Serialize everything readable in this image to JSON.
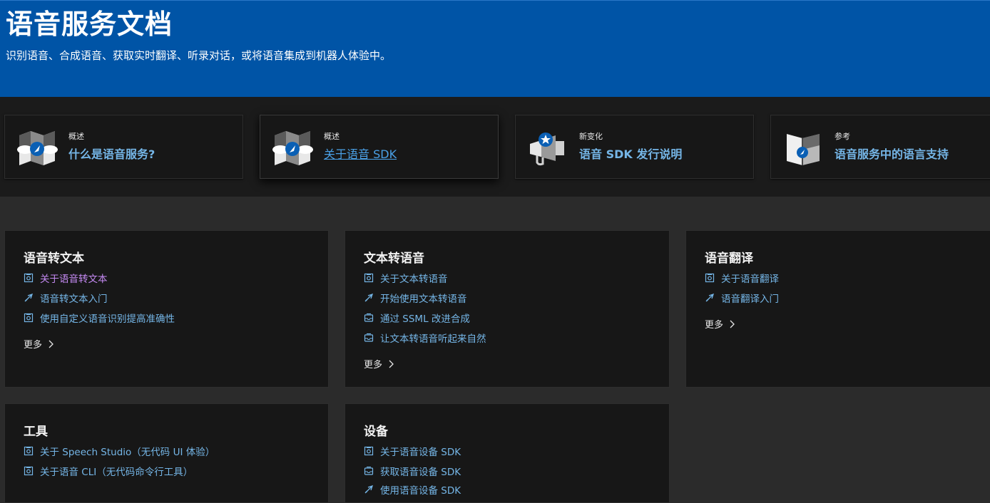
{
  "hero": {
    "title": "语音服务文档",
    "subtitle": "识别语音、合成语音、获取实时翻译、听录对话，或将语音集成到机器人体验中。"
  },
  "featured": [
    {
      "type": "概述",
      "title": "什么是语音服务?",
      "icon": "map-compass-icon"
    },
    {
      "type": "概述",
      "title": "关于语音 SDK",
      "icon": "map-compass-icon"
    },
    {
      "type": "新变化",
      "title": "语音 SDK 发行说明",
      "icon": "megaphone-star-icon"
    },
    {
      "type": "参考",
      "title": "语音服务中的语言支持",
      "icon": "book-compass-icon"
    }
  ],
  "sections": [
    {
      "title": "语音转文本",
      "links": [
        {
          "label": "关于语音转文本",
          "icon": "concept-icon"
        },
        {
          "label": "语音转文本入门",
          "icon": "rocket-icon"
        },
        {
          "label": "使用自定义语音识别提高准确性",
          "icon": "concept-icon"
        }
      ],
      "more": "更多"
    },
    {
      "title": "文本转语音",
      "links": [
        {
          "label": "关于文本转语音",
          "icon": "concept-icon"
        },
        {
          "label": "开始使用文本转语音",
          "icon": "rocket-icon"
        },
        {
          "label": "通过 SSML 改进合成",
          "icon": "how-to-icon"
        },
        {
          "label": "让文本转语音听起来自然",
          "icon": "how-to-icon"
        }
      ],
      "more": "更多"
    },
    {
      "title": "语音翻译",
      "links": [
        {
          "label": "关于语音翻译",
          "icon": "concept-icon"
        },
        {
          "label": "语音翻译入门",
          "icon": "rocket-icon"
        }
      ],
      "more": "更多"
    },
    {
      "title": "工具",
      "links": [
        {
          "label": "关于 Speech Studio（无代码 UI 体验）",
          "icon": "concept-icon"
        },
        {
          "label": "关于语音 CLI（无代码命令行工具）",
          "icon": "concept-icon"
        }
      ]
    },
    {
      "title": "设备",
      "links": [
        {
          "label": "关于语音设备 SDK",
          "icon": "concept-icon"
        },
        {
          "label": "获取语音设备 SDK",
          "icon": "how-to-icon"
        },
        {
          "label": "使用语音设备 SDK",
          "icon": "rocket-icon"
        }
      ]
    }
  ],
  "colors": {
    "hero_bg": "#0054a6",
    "link": "#75b6e7",
    "visited_link": "#c58af3",
    "page_bg": "#2b2b2b",
    "card_bg": "#171717"
  }
}
